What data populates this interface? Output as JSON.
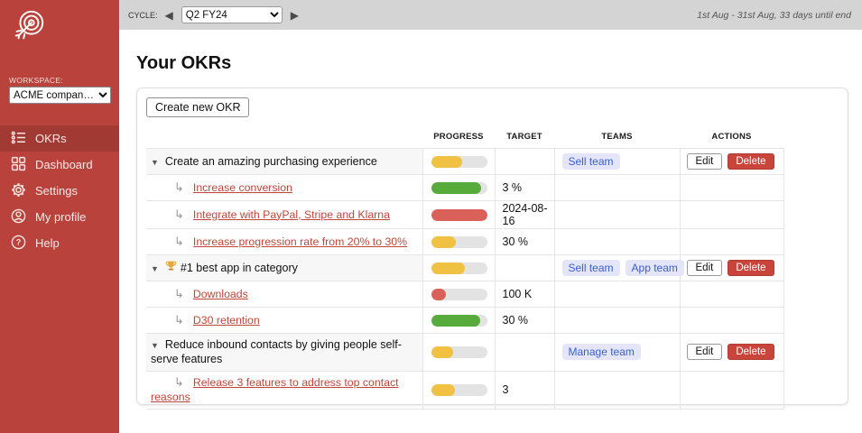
{
  "colors": {
    "sidebar": "#b9433c",
    "sidebar_active": "#a23a34",
    "topbar": "#d4d4d4",
    "yellow": "#f0c143",
    "green": "#56ab3b",
    "red": "#d96159",
    "track_gray": "#e3e3e3",
    "delete_red": "#c9453c",
    "link_red": "#c14538",
    "badge_bg": "#e5e5f9",
    "badge_text": "#3a5fc8"
  },
  "sidebar": {
    "logo_icon": "target-dart-logo",
    "workspace_label": "WORKSPACE:",
    "workspace_value": "ACME compan…",
    "nav": [
      {
        "label": "OKRs",
        "icon": "okr-list-icon",
        "active": true
      },
      {
        "label": "Dashboard",
        "icon": "dashboard-grid-icon",
        "active": false
      },
      {
        "label": "Settings",
        "icon": "gear-icon",
        "active": false
      },
      {
        "label": "My profile",
        "icon": "user-icon",
        "active": false
      },
      {
        "label": "Help",
        "icon": "help-icon",
        "active": false
      }
    ]
  },
  "topbar": {
    "cycle_label": "CYCLE:",
    "prev_icon": "◀",
    "cycle_value": "Q2 FY24",
    "next_icon": "▶",
    "date_range": "1st Aug - 31st Aug, 33 days until end"
  },
  "main": {
    "title": "Your OKRs",
    "create_button": "Create new OKR",
    "table": {
      "headers": [
        "PROGRESS",
        "TARGET",
        "TEAMS",
        "ACTIONS"
      ],
      "rows": [
        {
          "level": "objective",
          "title": "Create an amazing purchasing experience",
          "trophy": false,
          "progress": 55,
          "color": "yellow",
          "target": "",
          "teams": [
            "Sell team"
          ],
          "has_actions": true
        },
        {
          "level": "kr",
          "title": "Increase conversion",
          "progress": 90,
          "color": "green",
          "target": "3 %",
          "teams": [],
          "has_actions": false
        },
        {
          "level": "kr",
          "title": "Integrate with PayPal, Stripe and Klarna",
          "progress": 100,
          "color": "red",
          "target": "2024-08-16",
          "teams": [],
          "has_actions": false
        },
        {
          "level": "kr",
          "title": "Increase progression rate from 20% to 30%",
          "progress": 45,
          "color": "yellow",
          "target": "30 %",
          "teams": [],
          "has_actions": false
        },
        {
          "level": "objective",
          "title": "#1 best app in category",
          "trophy": true,
          "progress": 60,
          "color": "yellow",
          "target": "",
          "teams": [
            "Sell team",
            "App team"
          ],
          "has_actions": true
        },
        {
          "level": "kr",
          "title": "Downloads",
          "progress": 27,
          "color": "red",
          "target": "100 K",
          "teams": [],
          "has_actions": false
        },
        {
          "level": "kr",
          "title": "D30 retention",
          "progress": 88,
          "color": "green",
          "target": "30 %",
          "teams": [],
          "has_actions": false
        },
        {
          "level": "objective",
          "title": "Reduce inbound contacts by giving people self-serve features",
          "trophy": false,
          "progress": 40,
          "color": "yellow",
          "target": "",
          "teams": [
            "Manage team"
          ],
          "has_actions": true
        },
        {
          "level": "kr",
          "title": "Release 3 features to address top contact reasons",
          "progress": 42,
          "color": "yellow",
          "target": "3",
          "teams": [],
          "has_actions": false
        }
      ]
    }
  },
  "icons": {
    "expand": "▼",
    "sub_arrow": "↳",
    "trophy": "trophy-icon"
  },
  "action_labels": {
    "edit": "Edit",
    "delete": "Delete"
  }
}
